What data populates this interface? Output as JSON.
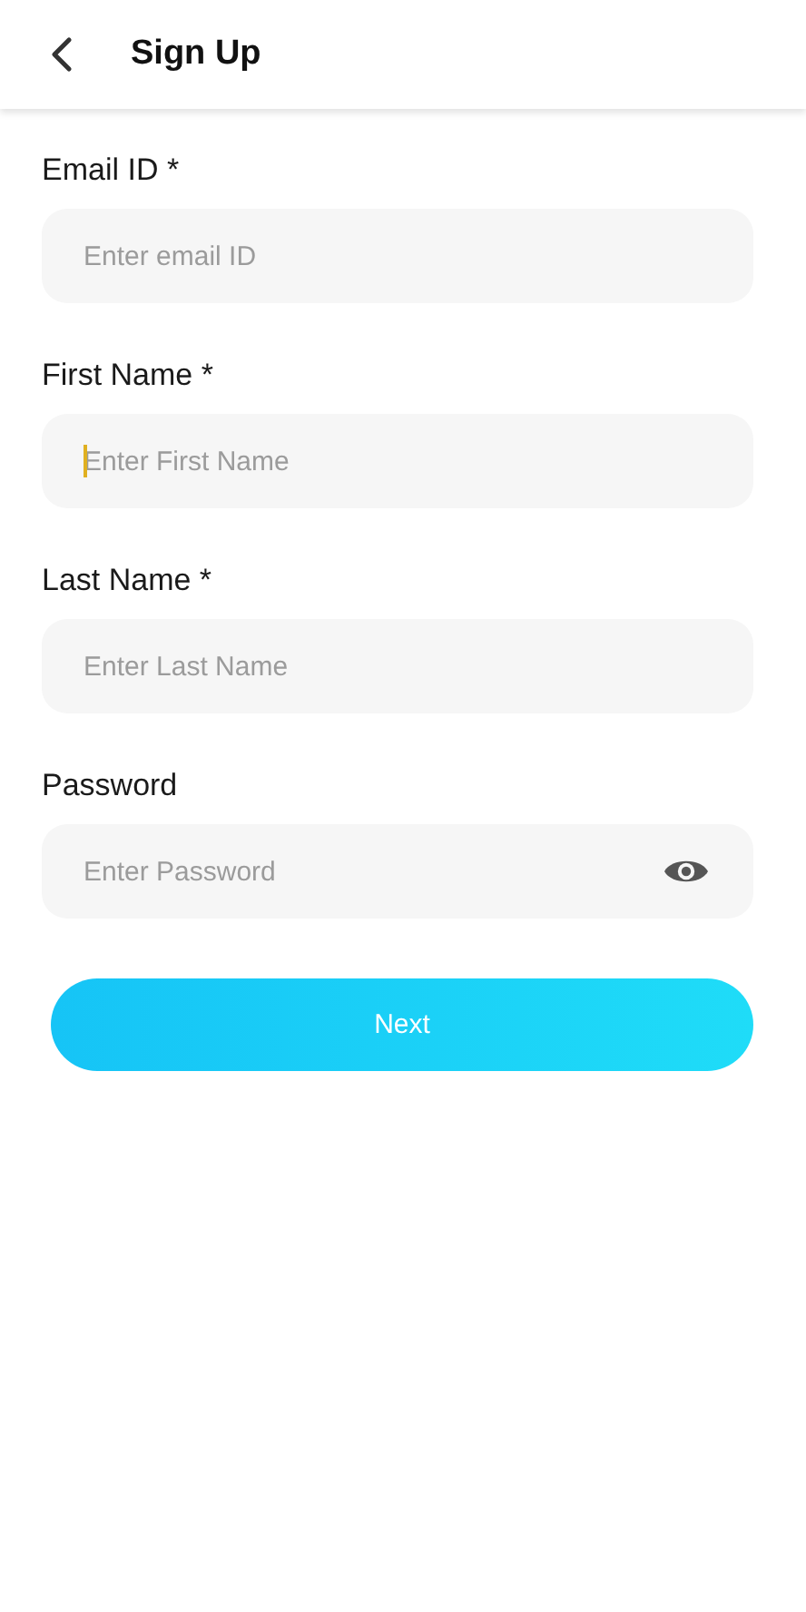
{
  "header": {
    "title": "Sign Up"
  },
  "fields": [
    {
      "label": "Email ID *",
      "placeholder": "Enter email ID",
      "kind": "text",
      "focused": false
    },
    {
      "label": "First Name *",
      "placeholder": "Enter First Name",
      "kind": "text",
      "focused": true
    },
    {
      "label": "Last Name *",
      "placeholder": "Enter Last Name",
      "kind": "text",
      "focused": false
    },
    {
      "label": "Password",
      "placeholder": "Enter Password",
      "kind": "password",
      "focused": false
    }
  ],
  "button": {
    "label": "Next"
  }
}
